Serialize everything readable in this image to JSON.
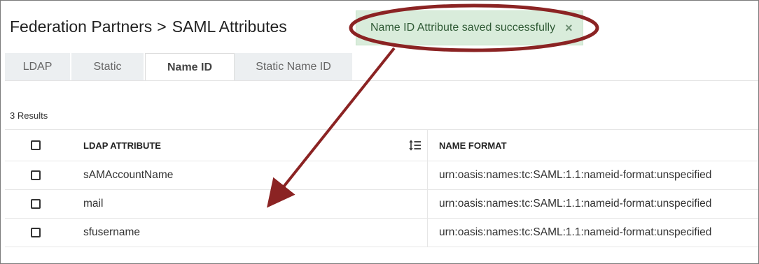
{
  "breadcrumb": {
    "parent": "Federation Partners",
    "separator": ">",
    "current": "SAML Attributes"
  },
  "tabs": [
    {
      "label": "LDAP",
      "active": false
    },
    {
      "label": "Static",
      "active": false
    },
    {
      "label": "Name ID",
      "active": true
    },
    {
      "label": "Static Name ID",
      "active": false
    }
  ],
  "results_count": "3 Results",
  "table": {
    "headers": {
      "attribute": "LDAP ATTRIBUTE",
      "format": "NAME FORMAT"
    },
    "rows": [
      {
        "attribute": "sAMAccountName",
        "format": "urn:oasis:names:tc:SAML:1.1:nameid-format:unspecified"
      },
      {
        "attribute": "mail",
        "format": "urn:oasis:names:tc:SAML:1.1:nameid-format:unspecified"
      },
      {
        "attribute": "sfusername",
        "format": "urn:oasis:names:tc:SAML:1.1:nameid-format:unspecified"
      }
    ]
  },
  "toast": {
    "message": "Name ID Attribute saved successfully",
    "close_glyph": "×",
    "color": "#d9ecdb"
  },
  "annotation": {
    "color": "#8b2323"
  }
}
